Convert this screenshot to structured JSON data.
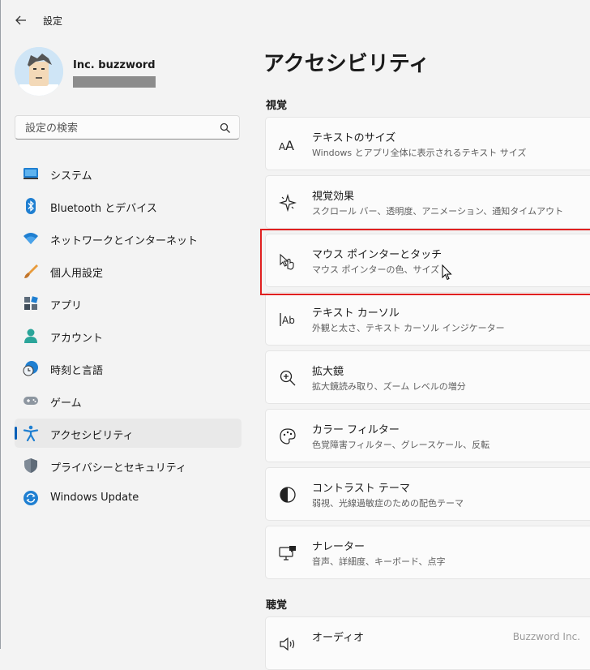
{
  "window": {
    "title": "設定"
  },
  "profile": {
    "name": "Inc. buzzword"
  },
  "search": {
    "placeholder": "設定の検索"
  },
  "sidebar": {
    "items": [
      {
        "label": "システム",
        "icon": "system-icon"
      },
      {
        "label": "Bluetooth とデバイス",
        "icon": "bluetooth-icon"
      },
      {
        "label": "ネットワークとインターネット",
        "icon": "wifi-icon"
      },
      {
        "label": "個人用設定",
        "icon": "brush-icon"
      },
      {
        "label": "アプリ",
        "icon": "apps-icon"
      },
      {
        "label": "アカウント",
        "icon": "account-icon"
      },
      {
        "label": "時刻と言語",
        "icon": "time-language-icon"
      },
      {
        "label": "ゲーム",
        "icon": "gamepad-icon"
      },
      {
        "label": "アクセシビリティ",
        "icon": "accessibility-icon",
        "active": true
      },
      {
        "label": "プライバシーとセキュリティ",
        "icon": "shield-icon"
      },
      {
        "label": "Windows Update",
        "icon": "windows-update-icon"
      }
    ]
  },
  "main": {
    "title": "アクセシビリティ",
    "sections": [
      {
        "heading": "視覚",
        "cards": [
          {
            "title": "テキストのサイズ",
            "subtitle": "Windows とアプリ全体に表示されるテキスト サイズ",
            "icon": "text-size-icon"
          },
          {
            "title": "視覚効果",
            "subtitle": "スクロール バー、透明度、アニメーション、通知タイムアウト",
            "icon": "visual-effects-icon"
          },
          {
            "title": "マウス ポインターとタッチ",
            "subtitle": "マウス ポインターの色、サイズ",
            "icon": "mouse-pointer-touch-icon"
          },
          {
            "title": "テキスト カーソル",
            "subtitle": "外観と太さ、テキスト カーソル インジケーター",
            "icon": "text-cursor-icon"
          },
          {
            "title": "拡大鏡",
            "subtitle": "拡大鏡読み取り、ズーム レベルの増分",
            "icon": "magnifier-icon"
          },
          {
            "title": "カラー フィルター",
            "subtitle": "色覚障害フィルター、グレースケール、反転",
            "icon": "color-filter-icon"
          },
          {
            "title": "コントラスト テーマ",
            "subtitle": "弱視、光線過敏症のための配色テーマ",
            "icon": "contrast-icon"
          },
          {
            "title": "ナレーター",
            "subtitle": "音声、詳細度、キーボード、点字",
            "icon": "narrator-icon"
          }
        ]
      },
      {
        "heading": "聴覚",
        "cards": [
          {
            "title": "オーディオ",
            "icon": "audio-icon"
          }
        ]
      }
    ]
  },
  "watermark": "Buzzword Inc.",
  "colors": {
    "accent": "#005fb8",
    "highlight": "#e02020"
  }
}
